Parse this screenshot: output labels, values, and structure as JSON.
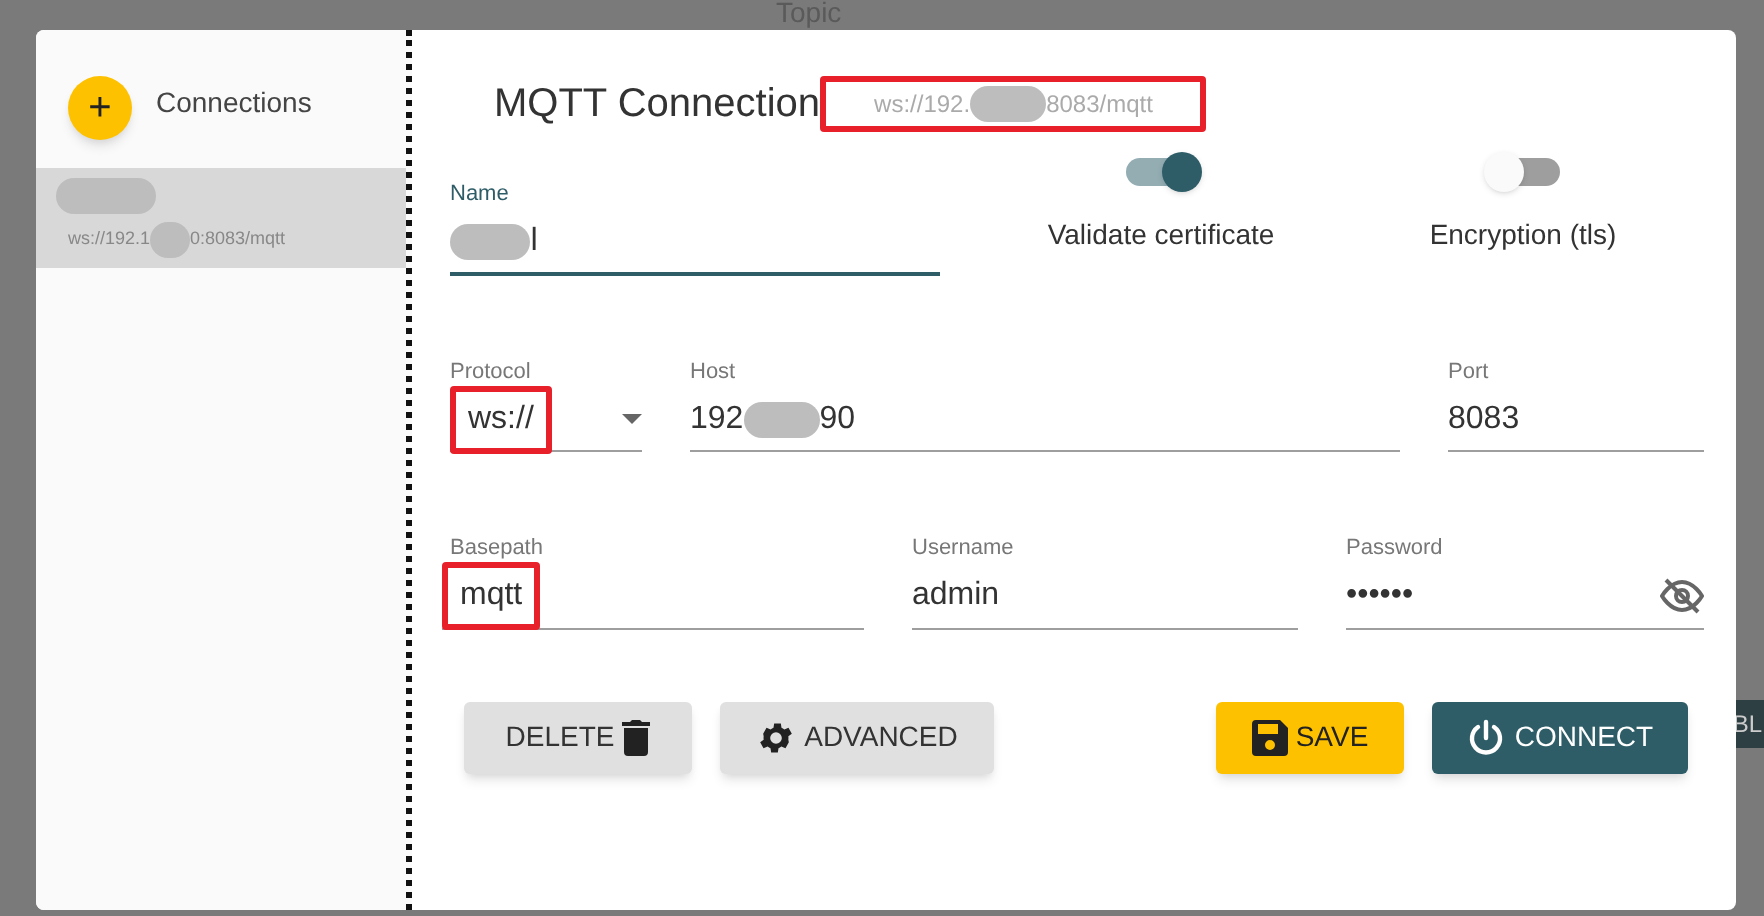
{
  "background": {
    "topic_label": "Topic",
    "cut_button_text": "BL"
  },
  "sidebar": {
    "add_button": "+",
    "title": "Connections",
    "connections": [
      {
        "url_start": "ws://192.1",
        "url_end": "0:8083/mqtt",
        "selected": true
      }
    ]
  },
  "header": {
    "title": "MQTT Connection",
    "url_start": "ws://192.",
    "url_end": "8083/mqtt",
    "highlighted": true
  },
  "name_field": {
    "label": "Name",
    "value_end": "ǀ"
  },
  "toggles": [
    {
      "label": "Validate certificate",
      "on": true
    },
    {
      "label": "Encryption (tls)",
      "on": false
    }
  ],
  "protocol": {
    "label": "Protocol",
    "value": "ws://",
    "highlighted": true
  },
  "host": {
    "label": "Host",
    "value_start": "192",
    "value_end": "90"
  },
  "port": {
    "label": "Port",
    "value": "8083"
  },
  "basepath": {
    "label": "Basepath",
    "value": "mqtt",
    "highlighted": true
  },
  "username": {
    "label": "Username",
    "value": "admin"
  },
  "password": {
    "label": "Password",
    "value": "••••••"
  },
  "buttons": [
    {
      "kind": "delete",
      "label": "DELETE"
    },
    {
      "kind": "advanced",
      "label": "ADVANCED"
    },
    {
      "kind": "save",
      "label": "SAVE"
    },
    {
      "kind": "connect",
      "label": "CONNECT"
    }
  ]
}
